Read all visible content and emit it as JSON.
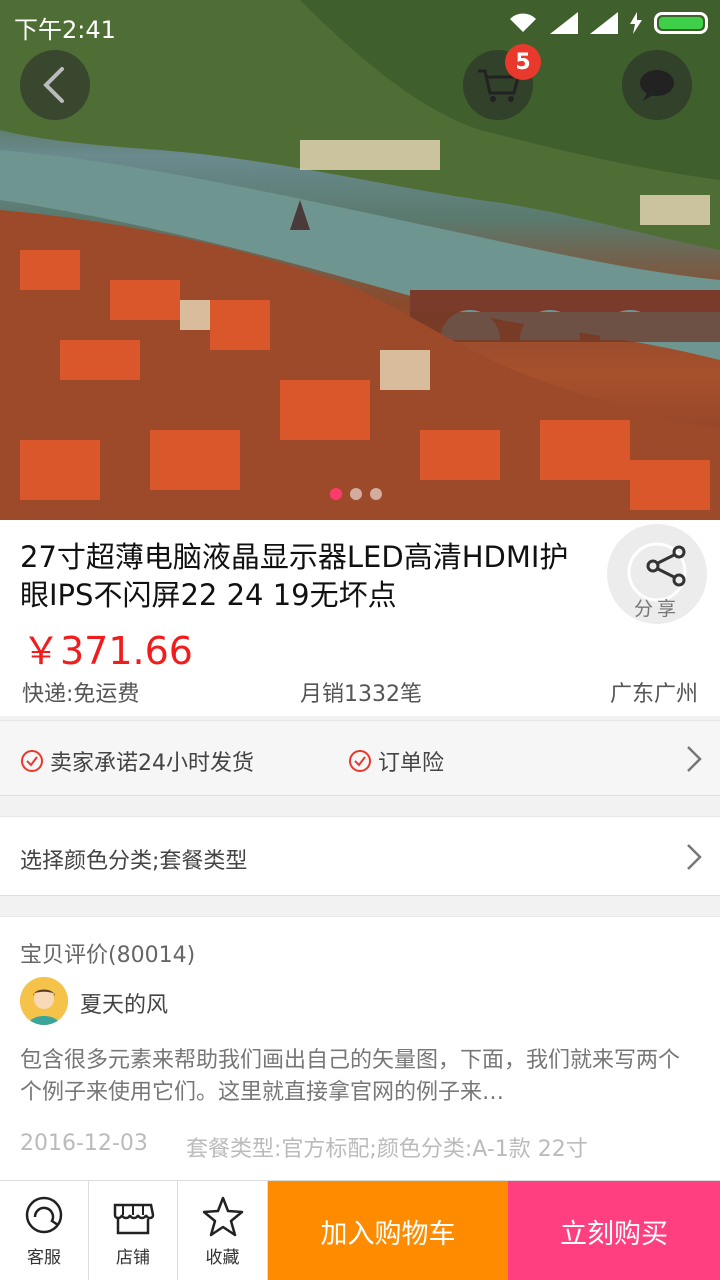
{
  "status_bar": {
    "time": "下午2:41"
  },
  "header": {
    "cart_count": "5"
  },
  "product": {
    "title": "27寸超薄电脑液晶显示器LED高清HDMI护眼IPS不闪屏22 24 19无坏点",
    "price": "￥371.66",
    "shipping": "快递:免运费",
    "monthly_sales": "月销1332笔",
    "location": "广东广州",
    "share_label": "分享"
  },
  "carousel": {
    "slides": 3,
    "active_index": 0
  },
  "promises": [
    "卖家承诺24小时发货",
    "订单险"
  ],
  "options": {
    "label": "选择颜色分类;套餐类型"
  },
  "reviews": {
    "heading": "宝贝评价(80014)",
    "reviewer": "夏天的风",
    "text": "包含很多元素来帮助我们画出自己的矢量图，下面，我们就来写两个个例子来使用它们。这里就直接拿官网的例子来…",
    "date": "2016-12-03",
    "spec": "套餐类型:官方标配;颜色分类:A-1款 22寸"
  },
  "bottom_bar": {
    "service": "客服",
    "store": "店铺",
    "favorite": "收藏",
    "add_to_cart": "加入购物车",
    "buy_now": "立刻购买"
  },
  "colors": {
    "price": "#f11d1d",
    "add_to_cart": "#ff8c00",
    "buy_now": "#ff3f80",
    "badge": "#e8392c"
  },
  "icons": [
    "back-icon",
    "cart-icon",
    "more-icon",
    "share-icon",
    "check-circle-icon",
    "chevron-right-icon",
    "service-icon",
    "store-icon",
    "star-icon",
    "wifi-icon",
    "signal-icon",
    "battery-icon"
  ]
}
